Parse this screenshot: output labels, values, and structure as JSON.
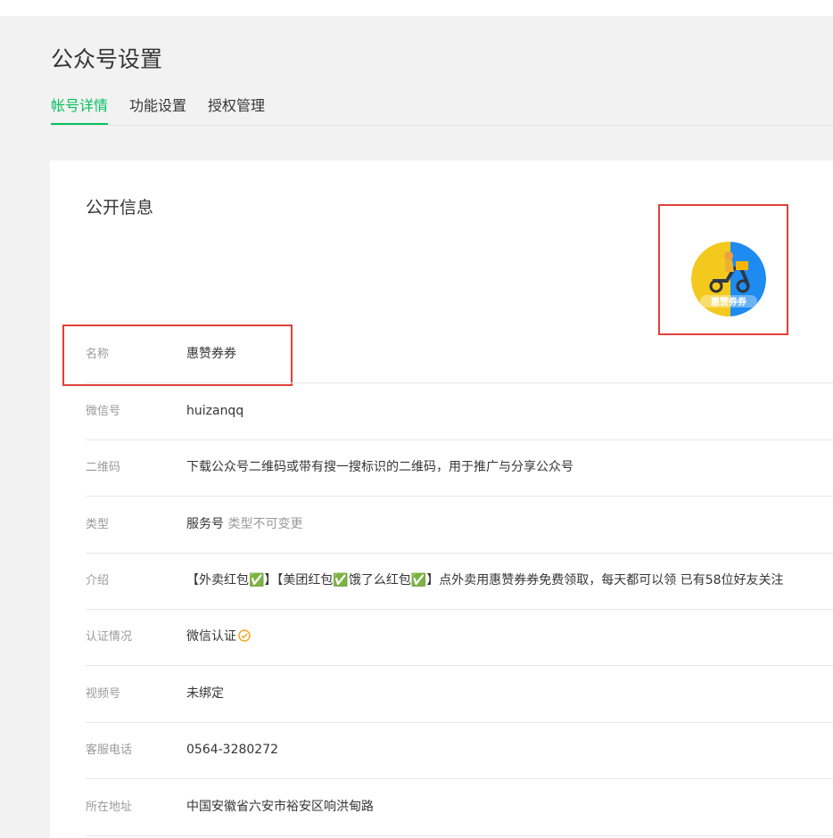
{
  "page": {
    "title": "公众号设置"
  },
  "tabs": [
    {
      "label": "帐号详情",
      "active": true
    },
    {
      "label": "功能设置",
      "active": false
    },
    {
      "label": "授权管理",
      "active": false
    }
  ],
  "section": {
    "title": "公开信息"
  },
  "avatar": {
    "icon": "delivery-scooter-logo",
    "caption": "惠赞券券",
    "colors": {
      "left": "#f4c91e",
      "right": "#1e8bf0"
    }
  },
  "rows": [
    {
      "label": "名称",
      "value": "惠赞券券"
    },
    {
      "label": "微信号",
      "value": "huizanqq"
    },
    {
      "label": "二维码",
      "value": "下载公众号二维码或带有搜一搜标识的二维码，用于推广与分享公众号"
    },
    {
      "label": "类型",
      "value": "服务号",
      "note": "类型不可变更"
    },
    {
      "label": "介绍",
      "value": "【外卖红包✅】【美团红包✅饿了么红包✅】点外卖用惠赞券券免费领取，每天都可以领 已有58位好友关注"
    },
    {
      "label": "认证情况",
      "value": "微信认证",
      "icon": "verified-check-icon"
    },
    {
      "label": "视频号",
      "value": "未绑定"
    },
    {
      "label": "客服电话",
      "value": "0564-3280272"
    },
    {
      "label": "所在地址",
      "value": "中国安徽省六安市裕安区响洪甸路"
    }
  ],
  "colors": {
    "accent": "#07c160",
    "highlight": "#e0413b",
    "verify": "#f5a623"
  }
}
